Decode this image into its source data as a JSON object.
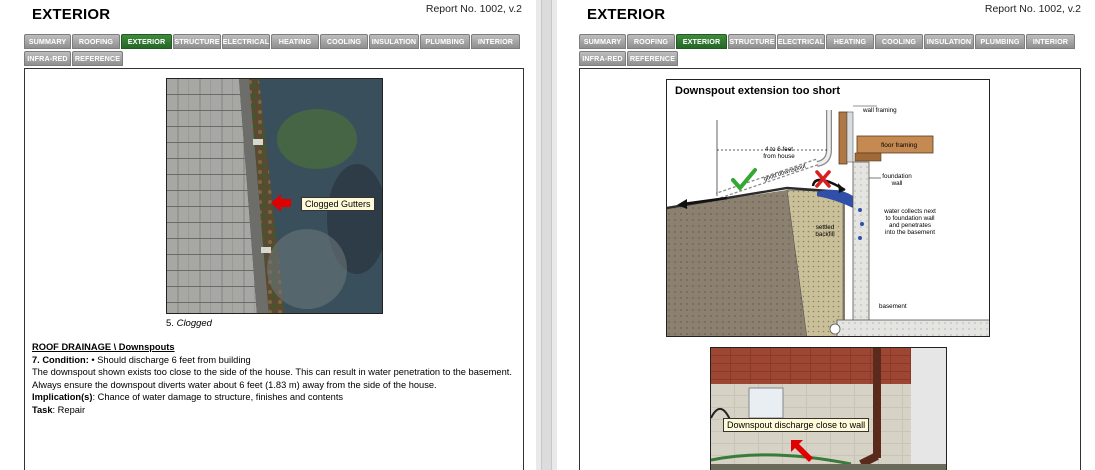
{
  "left_page": {
    "section_title": "EXTERIOR",
    "report_no": "Report No. 1002, v.2",
    "tabs_row1": [
      "SUMMARY",
      "ROOFING",
      "EXTERIOR",
      "STRUCTURE",
      "ELECTRICAL",
      "HEATING",
      "COOLING",
      "INSULATION",
      "PLUMBING",
      "INTERIOR"
    ],
    "tabs_row2": [
      "INFRA-RED",
      "REFERENCE"
    ],
    "active_tab": "EXTERIOR",
    "photo_callout": "Clogged Gutters",
    "photo_caption_number": "5.",
    "photo_caption_text": "Clogged",
    "heading": "ROOF DRAINAGE \\ Downspouts",
    "condition_label": "7.  Condition:",
    "condition_text": " • Should discharge 6 feet from building",
    "description": "The downspout shown exists too close to the side of the house. This can result in water penetration to the basement. Always ensure the downspout diverts water about 6 feet (1.83 m) away from the side of the house.",
    "implication_label": "Implication(s)",
    "implication_text": ": Chance of water damage to structure, finishes and contents",
    "task_label": "Task",
    "task_text": ": Repair"
  },
  "right_page": {
    "section_title": "EXTERIOR",
    "report_no": "Report No. 1002, v.2",
    "tabs_row1": [
      "SUMMARY",
      "ROOFING",
      "EXTERIOR",
      "STRUCTURE",
      "ELECTRICAL",
      "HEATING",
      "COOLING",
      "INSULATION",
      "PLUMBING",
      "INTERIOR"
    ],
    "tabs_row2": [
      "INFRA-RED",
      "REFERENCE"
    ],
    "active_tab": "EXTERIOR",
    "diagram": {
      "title": "Downspout extension too short",
      "wall_framing": "wall framing",
      "floor_framing": "floor framing",
      "distance_line1": "4 to 6 feet",
      "distance_line2": "from house",
      "good_downspout": "good downspout",
      "foundation_line1": "foundation",
      "foundation_line2": "wall",
      "water_line1": "water collects next",
      "water_line2": "to foundation wall",
      "water_line3": "and penetrates",
      "water_line4": "into the basement",
      "settled_line1": "settled",
      "settled_line2": "backfill",
      "basement": "basement"
    },
    "photo_callout": "Downspout discharge close to wall"
  },
  "colors": {
    "active_tab": "#2e7a2e",
    "tab": "#a0a0a0",
    "callout_bg": "#fffbd8"
  }
}
